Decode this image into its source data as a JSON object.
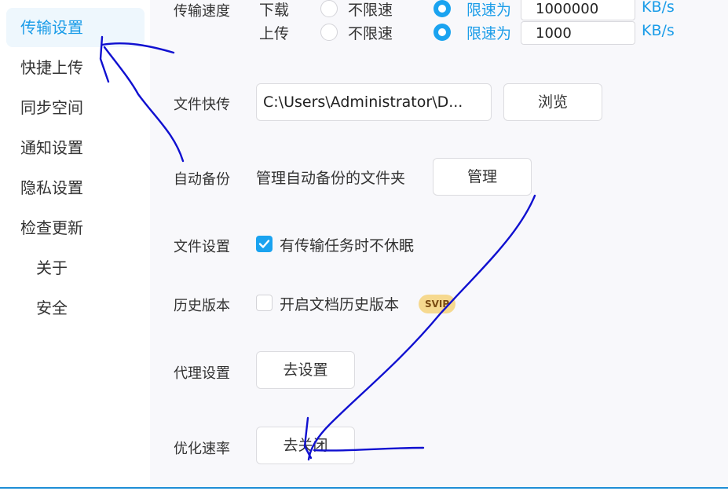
{
  "sidebar": {
    "items": [
      {
        "label": "传输设置",
        "active": true
      },
      {
        "label": "快捷上传"
      },
      {
        "label": "同步空间"
      },
      {
        "label": "通知设置"
      },
      {
        "label": "隐私设置"
      },
      {
        "label": "检查更新"
      },
      {
        "label": "关于"
      },
      {
        "label": "安全"
      }
    ]
  },
  "transfer_speed": {
    "label": "传输速度",
    "download": {
      "label": "下载",
      "unlimited_label": "不限速",
      "limit_label": "限速为",
      "value": "1000000",
      "unit": "KB/s",
      "selected": "limit"
    },
    "upload": {
      "label": "上传",
      "unlimited_label": "不限速",
      "limit_label": "限速为",
      "value": "1000",
      "unit": "KB/s",
      "selected": "limit"
    }
  },
  "file_quick_transfer": {
    "label": "文件快传",
    "path": "C:\\Users\\Administrator\\D...",
    "browse_label": "浏览"
  },
  "auto_backup": {
    "label": "自动备份",
    "description": "管理自动备份的文件夹",
    "manage_label": "管理"
  },
  "file_settings": {
    "label": "文件设置",
    "option": "有传输任务时不休眠",
    "checked": true
  },
  "history_version": {
    "label": "历史版本",
    "option": "开启文档历史版本",
    "checked": false,
    "badge": "SVIP"
  },
  "proxy": {
    "label": "代理设置",
    "button": "去设置"
  },
  "optimize": {
    "label": "优化速率",
    "button": "去关闭"
  },
  "colors": {
    "accent": "#1a9ce8",
    "annotation": "#1010d0",
    "badge": "#f6d98f"
  }
}
